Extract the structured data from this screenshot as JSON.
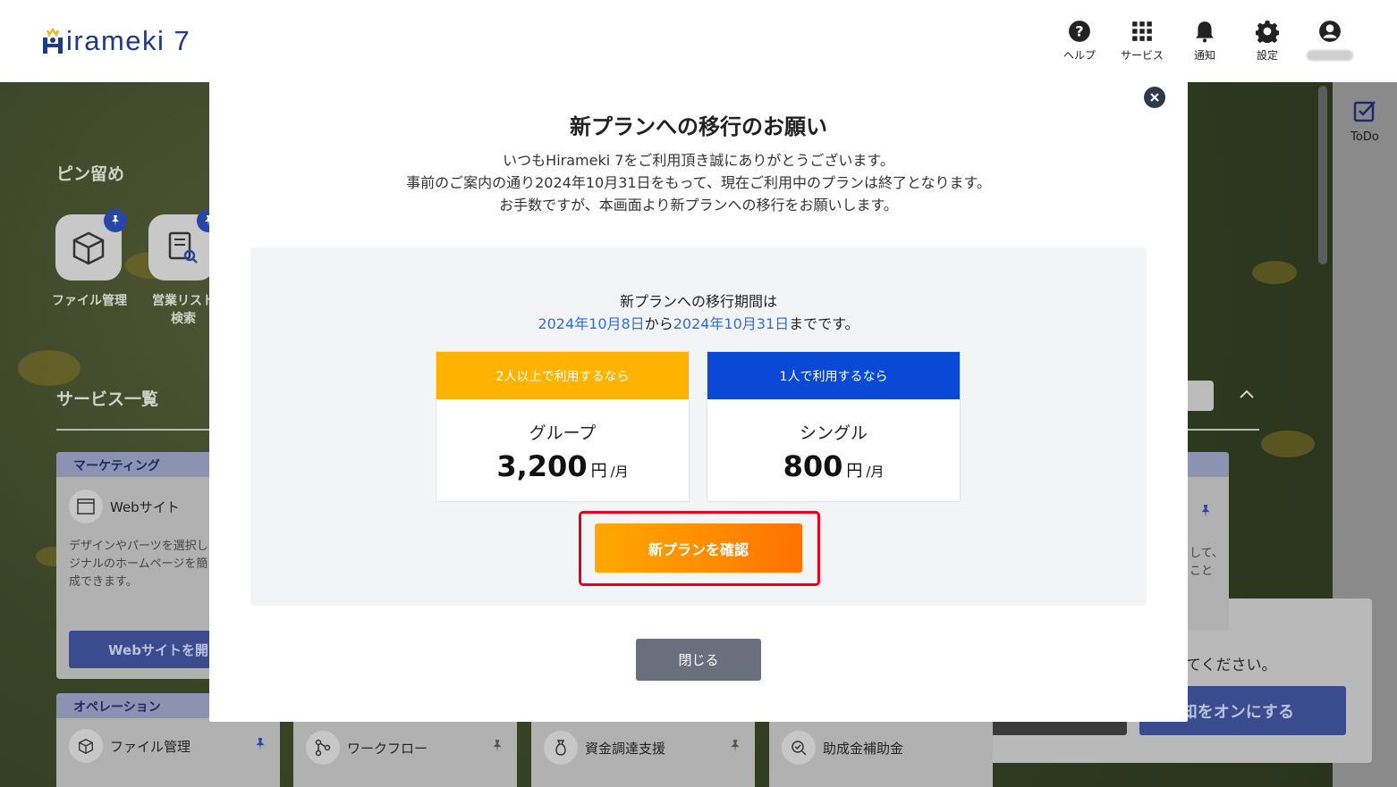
{
  "header": {
    "logo_text": "irameki 7",
    "icons": [
      {
        "icon": "help-icon",
        "label": "ヘルプ"
      },
      {
        "icon": "grid-icon",
        "label": "サービス"
      },
      {
        "icon": "bell-icon",
        "label": "通知"
      },
      {
        "icon": "gear-icon",
        "label": "設定"
      }
    ]
  },
  "background": {
    "pin_title": "ピン留め",
    "pins": [
      {
        "label": "ファイル管理"
      },
      {
        "label": "営業リスト\n検索"
      }
    ],
    "services_title": "サービス一覧",
    "marketing": {
      "category": "マーケティング",
      "service": "Webサイト",
      "desc_lines": [
        "デザインやパーツを選択し",
        "ジナルのホームページを簡",
        "成できます。"
      ],
      "button": "Webサイトを開"
    },
    "right_card_desc": [
      "して、",
      "こと"
    ],
    "operation": {
      "category": "オペレーション",
      "items": [
        "ファイル管理",
        "ワークフロー",
        "資金調達支援",
        "助成金補助金"
      ]
    },
    "todo_label": "ToDo",
    "notification": {
      "text": "てください。",
      "button": "通知をオンにする"
    }
  },
  "modal": {
    "title": "新プランへの移行のお願い",
    "message_lines": [
      "いつもHirameki 7をご利用頂き誠にありがとうございます。",
      "事前のご案内の通り2024年10月31日をもって、現在ご利用中のプランは終了となります。",
      "お手数ですが、本画面より新プランへの移行をお願いします。"
    ],
    "period_heading": "新プランへの移行期間は",
    "period_start": "2024年10月8日",
    "period_from": "から",
    "period_end": "2024年10月31日",
    "period_tail": "までです。",
    "plans": [
      {
        "header": "2人以上で利用するなら",
        "name": "グループ",
        "price": "3,200",
        "unit": "円",
        "per": "/月",
        "color": "#ffb300"
      },
      {
        "header": "1人で利用するなら",
        "name": "シングル",
        "price": "800",
        "unit": "円",
        "per": "/月",
        "color": "#0a49d6"
      }
    ],
    "confirm_button": "新プランを確認",
    "close_button": "閉じる"
  },
  "colors": {
    "accent_orange": "#ff8a00",
    "link_blue": "#2f6de0",
    "highlight_red": "#e5001c",
    "brand_blue": "#1f3a8a"
  }
}
